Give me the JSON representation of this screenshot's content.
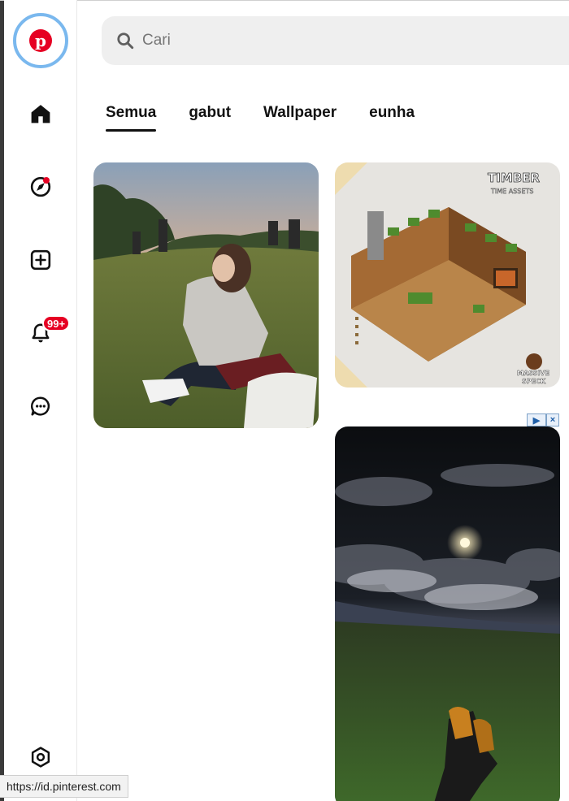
{
  "sidebar": {
    "logo_letter": "p",
    "notifications_badge": "99+"
  },
  "search": {
    "placeholder": "Cari"
  },
  "tabs": [
    {
      "label": "Semua"
    },
    {
      "label": "gabut"
    },
    {
      "label": "Wallpaper"
    },
    {
      "label": "eunha"
    }
  ],
  "pins": {
    "pin2": {
      "title": "TIMBER",
      "subtitle": "TIME ASSETS",
      "brand_line1": "MASSIVE",
      "brand_line2": "SPECK"
    }
  },
  "ad": {
    "info_glyph": "▶",
    "close_glyph": "×"
  },
  "status_bar": {
    "url": "https://id.pinterest.com"
  },
  "colors": {
    "brand": "#e60023",
    "focus_ring": "#7ab8ee",
    "search_bg": "#efefef"
  },
  "icons": [
    "pinterest-logo-icon",
    "home-icon",
    "compass-icon",
    "create-icon",
    "bell-icon",
    "chat-icon",
    "settings-icon",
    "search-icon"
  ]
}
